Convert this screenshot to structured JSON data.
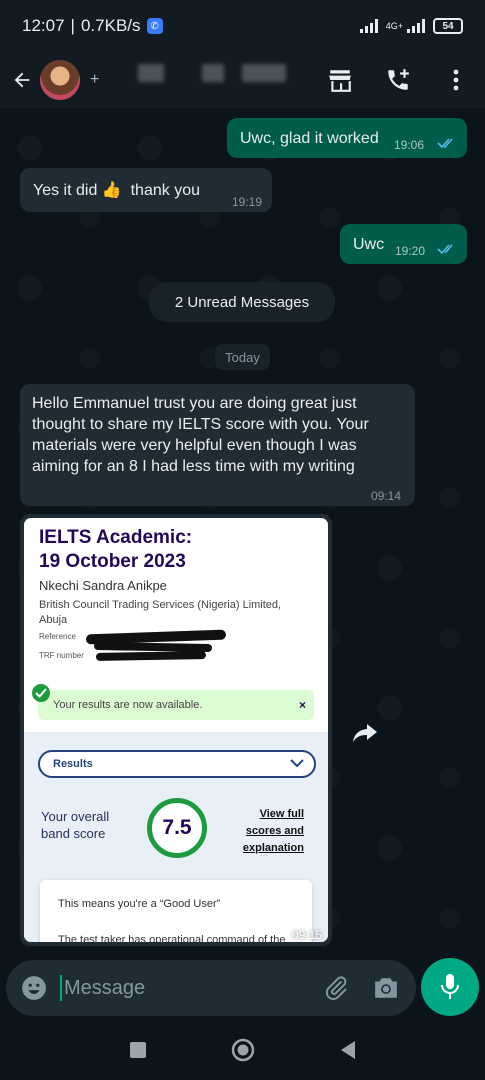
{
  "status_bar": {
    "time": "12:07",
    "speed": "0.7KB/s",
    "network_label": "4G+",
    "battery": "54"
  },
  "header": {
    "participants_suffix": "+",
    "icons": [
      "back-arrow-icon",
      "store-icon",
      "add-call-icon",
      "more-vertical-icon"
    ]
  },
  "messages": [
    {
      "direction": "out",
      "text": "Uwc, glad it worked",
      "time": "19:06"
    },
    {
      "direction": "in",
      "text": "Yes it did 👍  thank you",
      "time": "19:19"
    },
    {
      "direction": "out",
      "text": "Uwc",
      "time": "19:20"
    },
    {
      "direction": "in",
      "text": "Hello Emmanuel trust you are doing great just thought to share my IELTS score with you. Your materials were very helpful even though I was aiming for an 8 I had less time with my writing",
      "time": "09:14"
    }
  ],
  "unread_label": "2 Unread Messages",
  "date_divider": "Today",
  "image_message": {
    "time": "09:15",
    "ielts": {
      "title_line1": "IELTS Academic:",
      "title_line2": "19 October 2023",
      "candidate_name": "Nkechi Sandra Anikpe",
      "organization": "British Council Trading Services (Nigeria) Limited, Abuja",
      "reference_label": "Reference",
      "trf_label": "TRF number",
      "alert_text": "Your results are now available.",
      "alert_close": "×",
      "results_select": "Results",
      "overall_label": "Your overall band score",
      "band_score": "7.5",
      "view_full_link": "View full scores and explanation",
      "meaning_line1": "This means you're a “Good User”",
      "meaning_line2": "The test taker has operational command of the"
    }
  },
  "composer": {
    "placeholder": "Message"
  },
  "colors": {
    "outgoing_bubble": "#005c4b",
    "incoming_bubble": "#202c33",
    "accent": "#00a884",
    "read_ticks": "#53bdeb"
  }
}
